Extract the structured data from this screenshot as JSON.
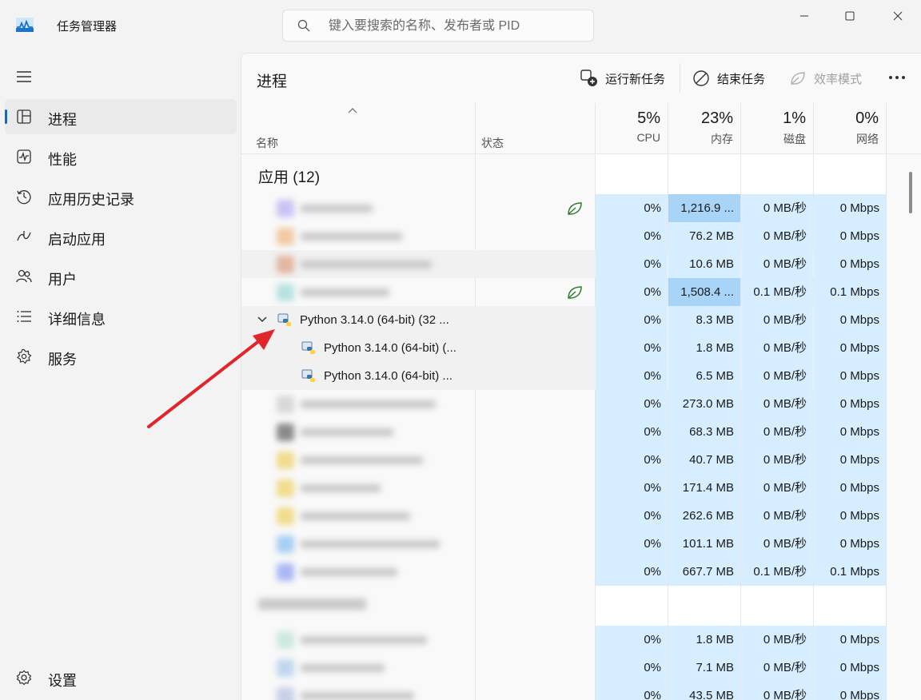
{
  "app": {
    "title": "任务管理器"
  },
  "search": {
    "placeholder": "键入要搜索的名称、发布者或 PID"
  },
  "sidebar": {
    "items": [
      {
        "label": "进程",
        "icon": "processes-icon",
        "active": true
      },
      {
        "label": "性能",
        "icon": "performance-icon"
      },
      {
        "label": "应用历史记录",
        "icon": "history-icon"
      },
      {
        "label": "启动应用",
        "icon": "startup-icon"
      },
      {
        "label": "用户",
        "icon": "users-icon"
      },
      {
        "label": "详细信息",
        "icon": "details-icon"
      },
      {
        "label": "服务",
        "icon": "services-icon"
      }
    ],
    "settings": "设置"
  },
  "toolbar": {
    "title": "进程",
    "run_new_task": "运行新任务",
    "end_task": "结束任务",
    "efficiency_mode": "效率模式"
  },
  "columns": {
    "name": "名称",
    "status": "状态",
    "cpu": {
      "pct": "5%",
      "label": "CPU"
    },
    "memory": {
      "pct": "23%",
      "label": "内存"
    },
    "disk": {
      "pct": "1%",
      "label": "磁盘"
    },
    "network": {
      "pct": "0%",
      "label": "网络"
    }
  },
  "groups": {
    "apps": "应用 (12)"
  },
  "rows": [
    {
      "name": "",
      "cpu": "0%",
      "mem": "1,216.9 ...",
      "disk": "0 MB/秒",
      "net": "0 Mbps",
      "eco": true,
      "hot": true
    },
    {
      "name": "",
      "cpu": "0%",
      "mem": "76.2 MB",
      "disk": "0 MB/秒",
      "net": "0 Mbps"
    },
    {
      "name": "",
      "cpu": "0%",
      "mem": "10.6 MB",
      "disk": "0 MB/秒",
      "net": "0 Mbps"
    },
    {
      "name": "",
      "cpu": "0%",
      "mem": "1,508.4 ...",
      "disk": "0.1 MB/秒",
      "net": "0.1 Mbps",
      "eco": true,
      "hot": true
    },
    {
      "name": "Python 3.14.0 (64-bit) (32 ...",
      "cpu": "0%",
      "mem": "8.3 MB",
      "disk": "0 MB/秒",
      "net": "0 Mbps",
      "expanded": true
    },
    {
      "name": "Python 3.14.0 (64-bit) (...",
      "cpu": "0%",
      "mem": "1.8 MB",
      "disk": "0 MB/秒",
      "net": "0 Mbps",
      "child": true
    },
    {
      "name": "Python 3.14.0 (64-bit) ...",
      "cpu": "0%",
      "mem": "6.5 MB",
      "disk": "0 MB/秒",
      "net": "0 Mbps",
      "child": true
    },
    {
      "name": "",
      "cpu": "0%",
      "mem": "273.0 MB",
      "disk": "0 MB/秒",
      "net": "0 Mbps"
    },
    {
      "name": "",
      "cpu": "0%",
      "mem": "68.3 MB",
      "disk": "0 MB/秒",
      "net": "0 Mbps"
    },
    {
      "name": "",
      "cpu": "0%",
      "mem": "40.7 MB",
      "disk": "0 MB/秒",
      "net": "0 Mbps"
    },
    {
      "name": "",
      "cpu": "0%",
      "mem": "171.4 MB",
      "disk": "0 MB/秒",
      "net": "0 Mbps"
    },
    {
      "name": "",
      "cpu": "0%",
      "mem": "262.6 MB",
      "disk": "0 MB/秒",
      "net": "0 Mbps"
    },
    {
      "name": "",
      "cpu": "0%",
      "mem": "101.1 MB",
      "disk": "0 MB/秒",
      "net": "0 Mbps"
    },
    {
      "name": "",
      "cpu": "0%",
      "mem": "667.7 MB",
      "disk": "0.1 MB/秒",
      "net": "0.1 Mbps"
    },
    {
      "name": "",
      "cpu": "0%",
      "mem": "1.8 MB",
      "disk": "0 MB/秒",
      "net": "0 Mbps"
    },
    {
      "name": "",
      "cpu": "0%",
      "mem": "7.1 MB",
      "disk": "0 MB/秒",
      "net": "0 Mbps"
    },
    {
      "name": "",
      "cpu": "0%",
      "mem": "43.5 MB",
      "disk": "0 MB/秒",
      "net": "0 Mbps"
    }
  ],
  "colors": {
    "accent": "#0f6cbd",
    "heat": "#d6eeff",
    "heat_strong": "#a8d4f7",
    "annotation": "#e0262b"
  }
}
